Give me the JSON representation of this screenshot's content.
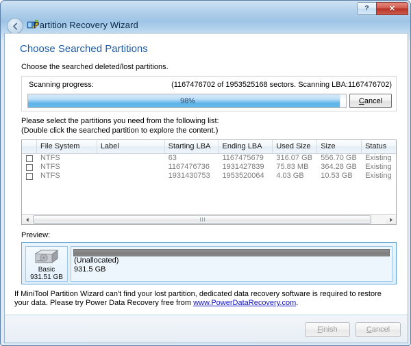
{
  "window": {
    "title": "Partition Recovery Wizard",
    "app_icon": "partition-wizard-icon",
    "back_button": "back-arrow",
    "help_button": "?",
    "close_button": "✕"
  },
  "page": {
    "heading": "Choose Searched Partitions",
    "subtitle": "Choose the searched deleted/lost partitions."
  },
  "progress": {
    "label": "Scanning progress:",
    "stats": "(1167476702 of 1953525168 sectors. Scanning LBA:1167476702)",
    "percent_text": "98%",
    "percent_value": 98,
    "sectors_done": 1167476702,
    "sectors_total": 1953525168,
    "scanning_lba": 1167476702,
    "cancel_label": "Cancel",
    "cancel_accel": "C",
    "cancel_rest": "ancel"
  },
  "list": {
    "instruction_line1": "Please select the partitions you need from the following list:",
    "instruction_line2": "(Double click the searched partition to explore the content.)",
    "columns": [
      "",
      "File System",
      "Label",
      "Starting LBA",
      "Ending LBA",
      "Used Size",
      "Size",
      "Status"
    ],
    "rows": [
      {
        "checked": false,
        "file_system": "NTFS",
        "label": "",
        "starting_lba": "63",
        "ending_lba": "1167475679",
        "used_size": "316.07 GB",
        "size": "556.70 GB",
        "status": "Existing"
      },
      {
        "checked": false,
        "file_system": "NTFS",
        "label": "",
        "starting_lba": "1167476736",
        "ending_lba": "1931427839",
        "used_size": "75.83 MB",
        "size": "364.28 GB",
        "status": "Existing"
      },
      {
        "checked": false,
        "file_system": "NTFS",
        "label": "",
        "starting_lba": "1931430753",
        "ending_lba": "1953520064",
        "used_size": "4.03 GB",
        "size": "10.53 GB",
        "status": "Existing"
      }
    ],
    "scrollbar": {
      "left_arrow": "◀",
      "right_arrow": "▶"
    }
  },
  "preview": {
    "label": "Preview:",
    "disk": {
      "icon": "hard-disk-icon",
      "type": "Basic",
      "capacity": "931.51 GB"
    },
    "partition": {
      "name": "(Unallocated)",
      "size": "931.5 GB"
    }
  },
  "note": {
    "text_before": "If MiniTool Partition Wizard can't find your lost partition, dedicated data recovery software is required to restore your data. Please try Power Data Recovery free from ",
    "link": "www.PowerDataRecovery.com",
    "text_after": "."
  },
  "footer": {
    "finish_label": "Finish",
    "finish_accel": "F",
    "finish_rest": "inish",
    "cancel_label": "Cancel",
    "cancel_accel": "C",
    "cancel_rest": "ancel"
  },
  "colors": {
    "heading": "#1c5ca8",
    "progress_fill": "#5cb4e8",
    "close_button": "#b83226",
    "link": "#1414c8",
    "unallocated_bar": "#858585"
  }
}
